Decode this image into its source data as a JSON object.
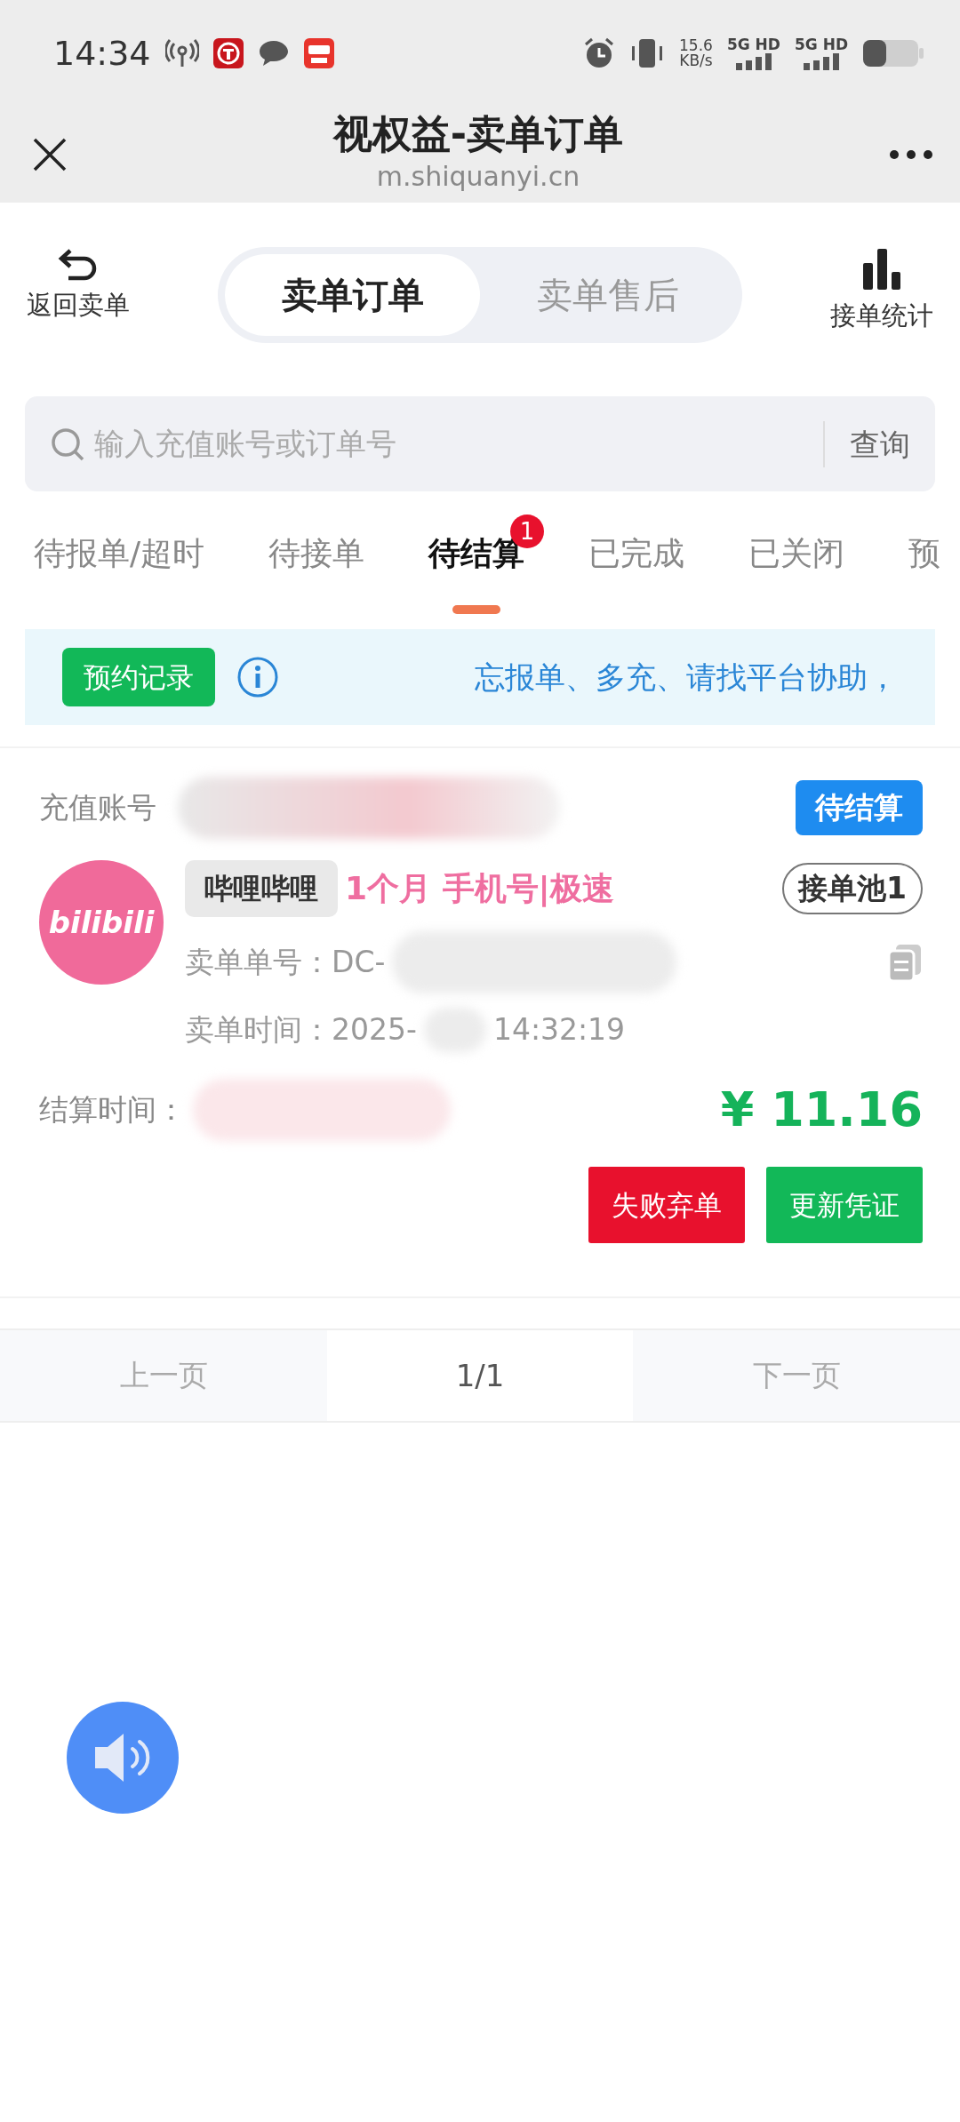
{
  "status_bar": {
    "time": "14:34",
    "speed": "15.6",
    "speed_unit": "KB/s",
    "network_1": "5G HD",
    "network_2": "5G HD"
  },
  "browser": {
    "title": "视权益-卖单订单",
    "url": "m.shiquanyi.cn"
  },
  "toolbar": {
    "back_label": "返回卖单",
    "segments": [
      {
        "label": "卖单订单",
        "selected": true
      },
      {
        "label": "卖单售后",
        "selected": false
      }
    ],
    "stats_label": "接单统计"
  },
  "search": {
    "placeholder": "输入充值账号或订单号",
    "button": "查询"
  },
  "status_tabs": [
    {
      "label": "待报单/超时",
      "selected": false
    },
    {
      "label": "待接单",
      "selected": false
    },
    {
      "label": "待结算",
      "selected": true,
      "badge": "1"
    },
    {
      "label": "已完成",
      "selected": false
    },
    {
      "label": "已关闭",
      "selected": false
    },
    {
      "label": "预",
      "selected": false
    }
  ],
  "notice": {
    "button": "预约记录",
    "text": "忘报单、多充、请找平台协助，"
  },
  "order": {
    "account_label": "充值账号",
    "status": "待结算",
    "logo_text": "bilibili",
    "platform": "哔哩哔哩",
    "product": "1个月 手机号|极速",
    "pool": "接单池1",
    "number": "卖单单号：DC-",
    "time_start": "卖单时间：2025-",
    "time_end": "14:32:19",
    "settle_label": "结算时间：",
    "price": "¥ 11.16",
    "actions": [
      {
        "label": "失败弃单",
        "kind": "danger"
      },
      {
        "label": "更新凭证",
        "kind": "success"
      }
    ]
  },
  "pagination": {
    "prev": "上一页",
    "page": "1/1",
    "next": "下一页"
  }
}
